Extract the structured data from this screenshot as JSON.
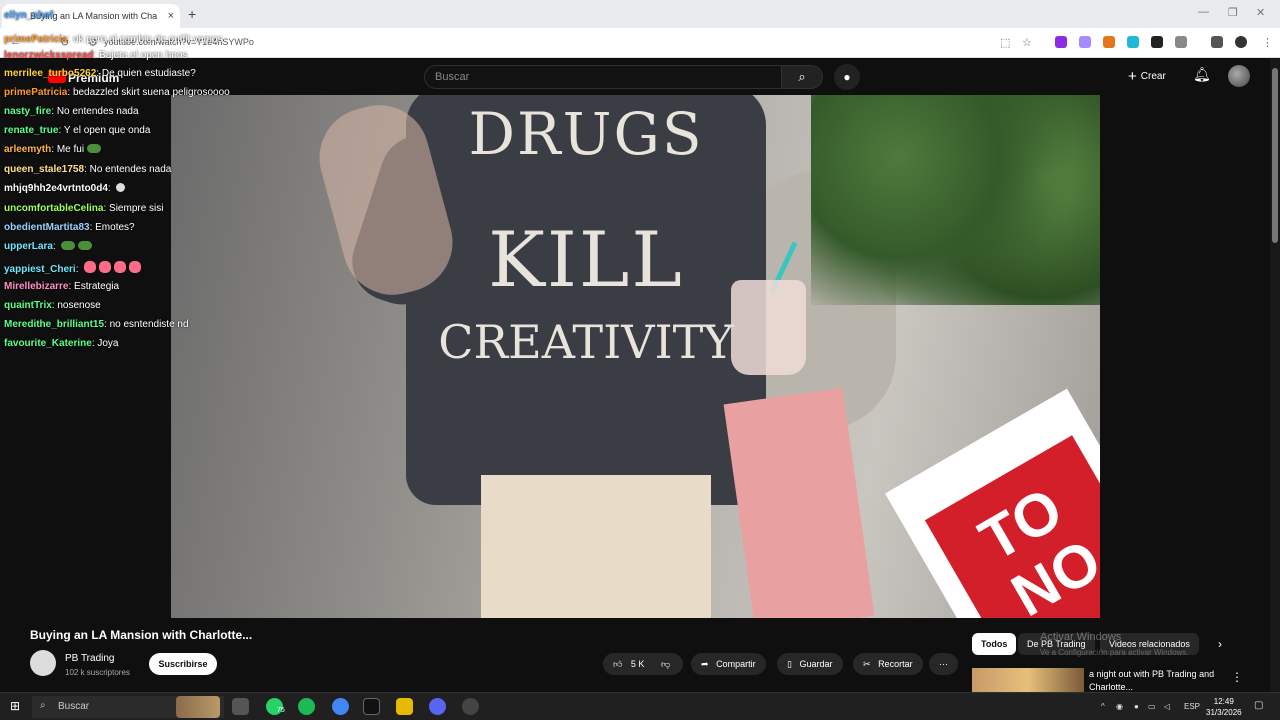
{
  "browser": {
    "tab_title": "Buying an LA Mansion with Cha",
    "url": "youtube.com/watch?v=Y1e4nSYWPo",
    "new_tab": "+",
    "close": "×"
  },
  "youtube": {
    "logo_text": "Premium",
    "search_placeholder": "Buscar",
    "create_label": "Crear"
  },
  "chat": [
    {
      "user": "ellyn_chef",
      "color": "#4aa3ff",
      "text": ""
    },
    {
      "user": "primePatricia",
      "color": "#ff9b2f",
      "text": "ok pero al cambio de outfit vamos"
    },
    {
      "user": "lenorzwicksspread",
      "color": "#ff4d4d",
      "text": "Bajeta el open hnos"
    },
    {
      "user": "merrilee_turbo5262",
      "color": "#ffd23f",
      "text": "De quien estudiaste?"
    },
    {
      "user": "primePatricia",
      "color": "#ff9b2f",
      "text": "bedazzled skirt suena peligrosoooo"
    },
    {
      "user": "nasty_fire",
      "color": "#5bff8a",
      "text": "No entendes nada"
    },
    {
      "user": "renate_true",
      "color": "#5bff8a",
      "text": "Y el open que onda"
    },
    {
      "user": "arleemyth",
      "color": "#ffb347",
      "text": "Me fui"
    },
    {
      "user": "queen_stale1758",
      "color": "#ffe08a",
      "text": "No entendes nada"
    },
    {
      "user": "mhjq9hh2e4vrtnto0d4",
      "color": "#ffffff",
      "text": ""
    },
    {
      "user": "uncomfortableCelina",
      "color": "#9dff5b",
      "text": "Siempre sisi"
    },
    {
      "user": "obedientMartita83",
      "color": "#9ad0ff",
      "text": "Emotes?"
    },
    {
      "user": "upperLara",
      "color": "#6ee7ff",
      "text": ""
    },
    {
      "user": "yappiest_Cheri",
      "color": "#6ee7ff",
      "text": ""
    },
    {
      "user": "Mirellebizarre",
      "color": "#ff8ec6",
      "text": "Estrategia"
    },
    {
      "user": "quaintTrix",
      "color": "#5bff8a",
      "text": "nosenose"
    },
    {
      "user": "Meredithe_brilliant15",
      "color": "#5bff8a",
      "text": "no esntendiste nd"
    },
    {
      "user": "favourite_Katerine",
      "color": "#5bff8a",
      "text": "Joya"
    }
  ],
  "video": {
    "shirt_line1": "DRUGS",
    "shirt_line2": "KILL",
    "shirt_line3": "CREATIVITY",
    "sign_text": "TO NO"
  },
  "info": {
    "title": "Buying an LA Mansion with Charlotte...",
    "channel": "PB Trading",
    "subscribers": "102 k suscriptores",
    "subscribe_label": "Suscribirse",
    "likes": "5 K",
    "share_label": "Compartir",
    "save_label": "Guardar",
    "clip_label": "Recortar",
    "more_label": "···"
  },
  "related": {
    "chips": [
      "Todos",
      "De PB Trading",
      "Videos relacionados"
    ],
    "first_title": "a night out with PB Trading and Charlotte...",
    "watermark_title": "Activar Windows",
    "watermark_sub": "Ve a Configuración para activar Windows."
  },
  "taskbar": {
    "search_label": "Buscar",
    "whatsapp_badge": "75",
    "lang": "ESP",
    "time": "12:49",
    "date": "31/3/2026"
  }
}
